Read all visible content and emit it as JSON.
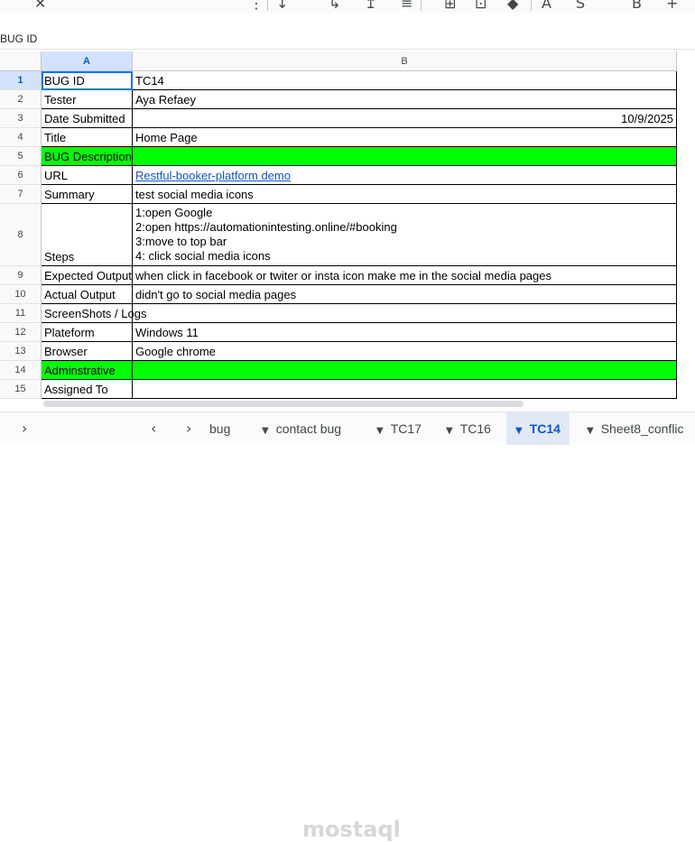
{
  "toolbar": {
    "icons": [
      "close-icon",
      "more-vert-icon",
      "vertical-align-icon",
      "text-wrap-icon",
      "text-rotation-icon",
      "horizontal-align-icon",
      "merge-cells-icon",
      "borders-icon",
      "fill-color-icon",
      "text-color-icon",
      "strikethrough-icon",
      "bold-icon",
      "add-icon"
    ],
    "glyphs": {
      "close": "✕",
      "more": "⋮",
      "valign": "↧",
      "wrap": "↳",
      "rotate": "↥",
      "align": "≡",
      "merge": "⊞",
      "borders": "⊡",
      "fill": "◆",
      "textcolor": "A",
      "strike": "S",
      "bold": "B",
      "add": "+"
    }
  },
  "namebox": {
    "value": "BUG ID"
  },
  "columns": [
    "A",
    "B"
  ],
  "rows": [
    {
      "num": "1",
      "a": "BUG ID",
      "b": "TC14"
    },
    {
      "num": "2",
      "a": "Tester",
      "b": "Aya Refaey"
    },
    {
      "num": "3",
      "a": "Date Submitted",
      "b": "10/9/2025"
    },
    {
      "num": "4",
      "a": "Title",
      "b": "Home Page"
    },
    {
      "num": "5",
      "a": "BUG Description",
      "b": ""
    },
    {
      "num": "6",
      "a": "URL",
      "b": "Restful-booker-platform demo"
    },
    {
      "num": "7",
      "a": "Summary",
      "b": "test social media icons"
    },
    {
      "num": "8",
      "a": "Steps",
      "b_lines": [
        "1:open Google",
        "2:open https://automationintesting.online/#booking",
        "3:move to top bar",
        "4:  click social media icons"
      ]
    },
    {
      "num": "9",
      "a": "Expected Output",
      "b": "when click in facebook   or twiter or insta icon make me in the social media pages"
    },
    {
      "num": "10",
      "a": "Actual Output",
      "b": "didn't go to social media pages"
    },
    {
      "num": "11",
      "a": "ScreenShots / Logs",
      "b": ""
    },
    {
      "num": "12",
      "a": "Plateform",
      "b": "Windows 11"
    },
    {
      "num": "13",
      "a": "Browser",
      "b": "Google chrome"
    },
    {
      "num": "14",
      "a": "Adminstrative",
      "b": ""
    },
    {
      "num": "15",
      "a": "Assigned To",
      "b": ""
    }
  ],
  "colors": {
    "section_green": "#00ff00",
    "selection_blue": "#d3e3fd",
    "link": "#1155cc"
  },
  "tabs": {
    "nav_glyphs": {
      "expand": "›",
      "prev": "‹",
      "next": "›",
      "caret": "▼"
    },
    "items": [
      "bug",
      "contact bug",
      "TC17",
      "TC16",
      "TC14",
      "Sheet8_conflic"
    ],
    "active": "TC14"
  },
  "watermark": "mostaql"
}
